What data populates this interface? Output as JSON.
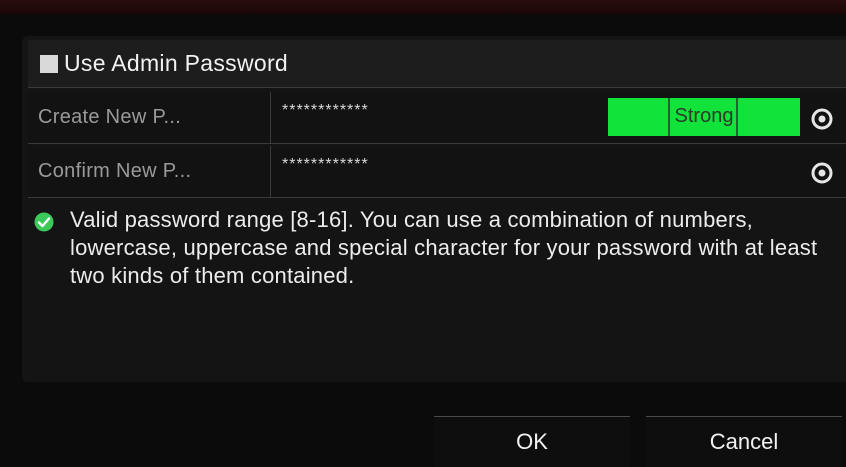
{
  "admin": {
    "label": "Use Admin Password",
    "checked": false
  },
  "create_password": {
    "label": "Create New P...",
    "value": "************",
    "strength": "Strong",
    "strength_color": "#11e33a"
  },
  "confirm_password": {
    "label": "Confirm New P...",
    "value": "************"
  },
  "hint": {
    "text": "Valid password range [8-16]. You can use a combination of numbers, lowercase, uppercase and special character for your password with at least two kinds of them contained.",
    "icon": "check-circle-icon",
    "icon_color": "#3cc95a"
  },
  "buttons": {
    "ok": "OK",
    "cancel": "Cancel"
  }
}
